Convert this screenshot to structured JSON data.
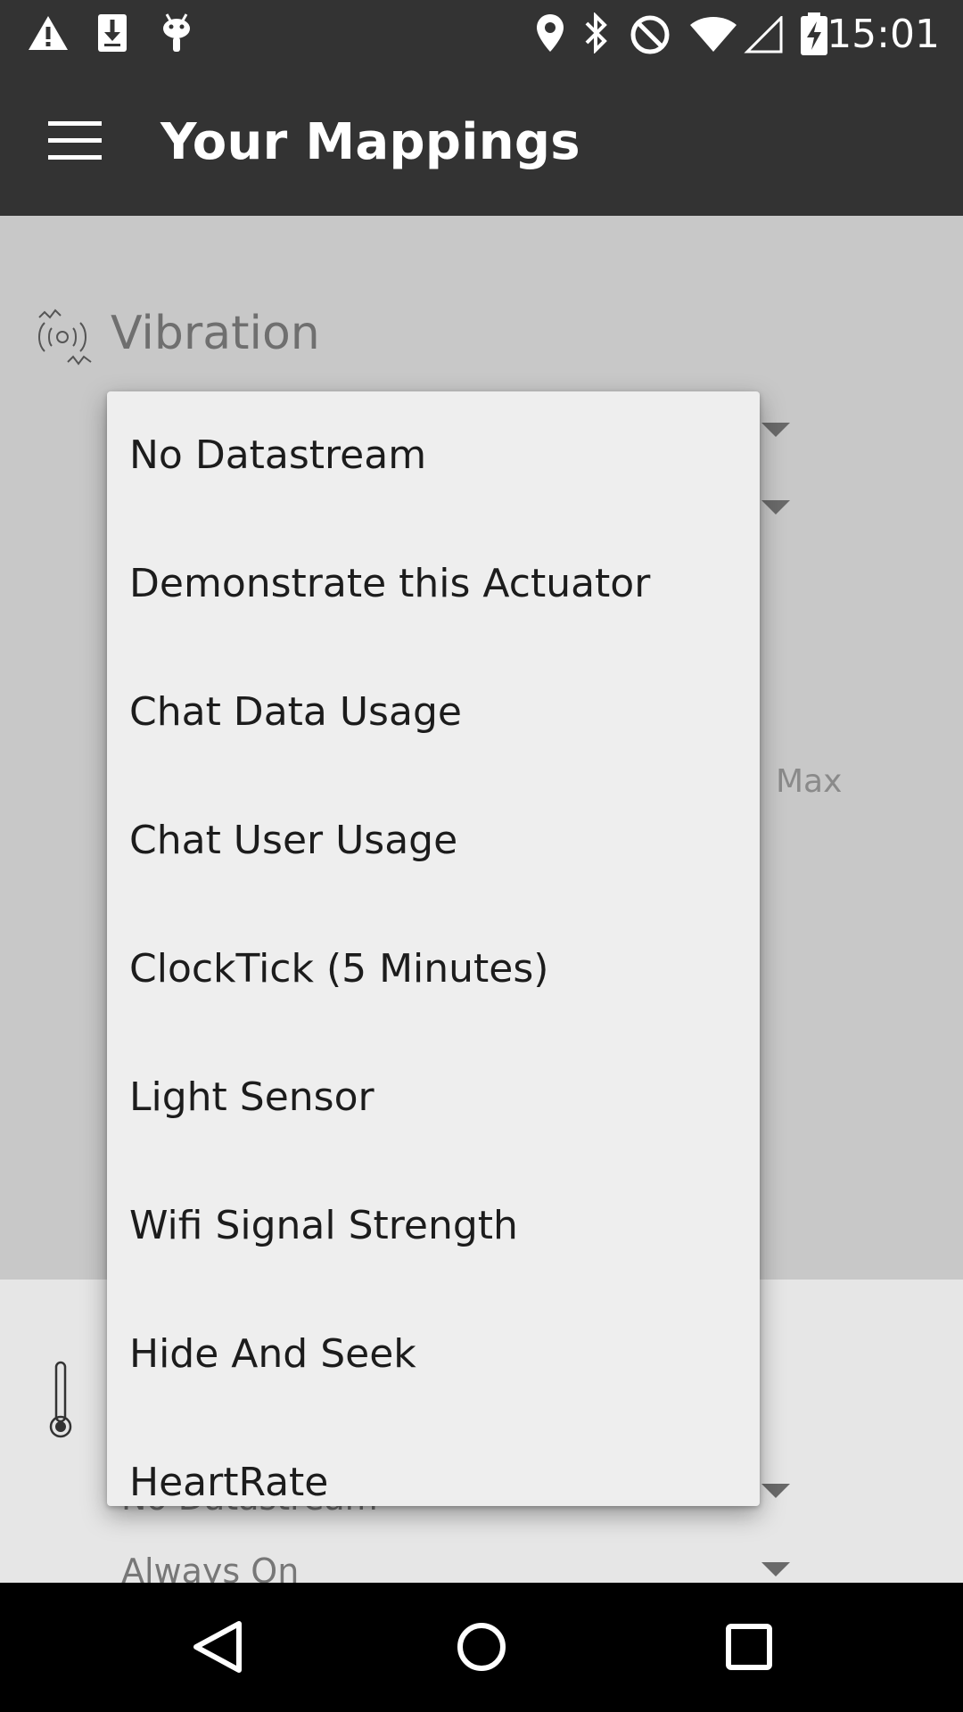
{
  "status_bar": {
    "time": "15:01",
    "left_icons": [
      "warning-icon",
      "download-icon",
      "android-debug-icon"
    ],
    "right_icons": [
      "location-icon",
      "bluetooth-icon",
      "do-not-disturb-icon",
      "wifi-icon",
      "signal-icon",
      "battery-charging-icon"
    ]
  },
  "app_bar": {
    "title": "Your Mappings",
    "menu_icon": "hamburger-menu-icon"
  },
  "mapping_1": {
    "title": "Vibration",
    "icon": "vibration-icon",
    "max_label": "Max"
  },
  "mapping_2": {
    "icon": "thermometer-icon",
    "datastream_value": "No Datastream",
    "mode_value": "Always On"
  },
  "dropdown": {
    "items": [
      "No Datastream",
      "Demonstrate this Actuator",
      "Chat Data Usage",
      "Chat User Usage",
      "ClockTick (5 Minutes)",
      "Light Sensor",
      "Wifi Signal Strength",
      "Hide And Seek",
      "HeartRate"
    ]
  },
  "nav_bar": {
    "buttons": [
      "back-icon",
      "home-icon",
      "recents-icon"
    ]
  },
  "colors": {
    "app_bar": "#333333",
    "dimmed_background": "#c8c8c8",
    "dropdown_background": "#eeeeee",
    "nav_bar": "#000000"
  }
}
